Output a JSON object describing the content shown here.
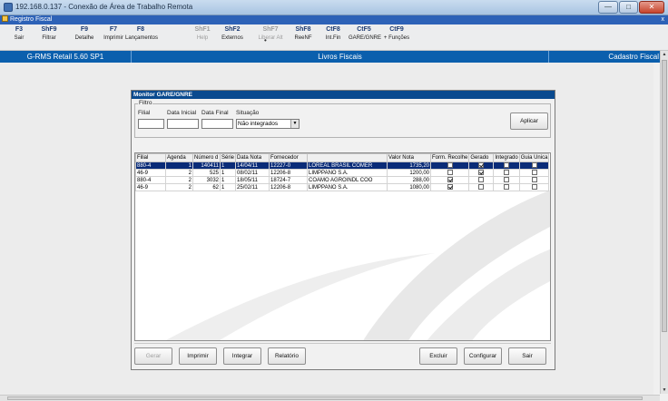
{
  "remote_window": {
    "title": "192.168.0.137 - Conexão de Área de Trabalho Remota",
    "min_label": "—",
    "max_label": "□",
    "close_label": "✕"
  },
  "app": {
    "title": "Registro Fiscal",
    "close_label": "x"
  },
  "toolbar": [
    {
      "key": "F3",
      "label": "Sair",
      "enabled": true
    },
    {
      "key": "ShF9",
      "label": "Filtrar",
      "enabled": true
    },
    {
      "key": "F9",
      "label": "Detalhe",
      "enabled": true
    },
    {
      "key": "F7",
      "label": "Imprimir",
      "enabled": true
    },
    {
      "key": "F8",
      "label": "Lançamentos",
      "enabled": true
    },
    {
      "key": "ShF1",
      "label": "Help",
      "enabled": false
    },
    {
      "key": "ShF2",
      "label": "Externos",
      "enabled": true
    },
    {
      "key": "ShF7",
      "label": "Liberar Alt",
      "enabled": false
    },
    {
      "key": "ShF8",
      "label": "ReeNF",
      "enabled": true
    },
    {
      "key": "CtF8",
      "label": "Int.Fin",
      "enabled": true
    },
    {
      "key": "CtF5",
      "label": "GARE/GNRE",
      "enabled": true
    },
    {
      "key": "CtF9",
      "label": "+ Funções",
      "enabled": true
    }
  ],
  "status_bar": {
    "product": "G-RMS Retail 5.60 SP1",
    "module": "Livros Fiscais",
    "section": "Cadastro Fiscal"
  },
  "dialog": {
    "title": "Monitor GARE/GNRE",
    "filter": {
      "legend": "Filtro",
      "filial_label": "Filial",
      "filial_value": "",
      "data_inicial_label": "Data Inicial",
      "data_inicial_value": "",
      "data_final_label": "Data Final",
      "data_final_value": "",
      "situacao_label": "Situação",
      "situacao_value": "Não integrados",
      "apply_label": "Aplicar"
    },
    "table": {
      "columns": [
        "Filial",
        "Agenda",
        "Número d",
        "Série",
        "Data Nota",
        "Fornecedor",
        "",
        "Valor Nota",
        "Form. Recolhe",
        "Gerado",
        "Integrado",
        "Guia Única"
      ],
      "rows": [
        {
          "filial": "880-4",
          "agenda": "1",
          "numero": "140411",
          "serie": "1",
          "data": "14/04/11",
          "forn_code": "12227-0",
          "forn_name": "LOREAL BRASIL COMER",
          "valor": "1735,20",
          "form": false,
          "gerado": true,
          "integrado": false,
          "guia": false,
          "selected": true
        },
        {
          "filial": "46-9",
          "agenda": "2",
          "numero": "525",
          "serie": "1",
          "data": "08/02/11",
          "forn_code": "12206-8",
          "forn_name": "LIMPPANO S.A.",
          "valor": "1200,00",
          "form": false,
          "gerado": true,
          "integrado": false,
          "guia": false,
          "selected": false
        },
        {
          "filial": "880-4",
          "agenda": "2",
          "numero": "3032",
          "serie": "1",
          "data": "18/05/11",
          "forn_code": "18724-7",
          "forn_name": "COAMO AGROINDL COO",
          "valor": "288,00",
          "form": true,
          "gerado": false,
          "integrado": false,
          "guia": false,
          "selected": false
        },
        {
          "filial": "46-9",
          "agenda": "2",
          "numero": "62",
          "serie": "1",
          "data": "25/02/11",
          "forn_code": "12206-8",
          "forn_name": "LIMPPANO S.A.",
          "valor": "1080,00",
          "form": true,
          "gerado": false,
          "integrado": false,
          "guia": false,
          "selected": false
        }
      ]
    },
    "buttons": {
      "gerar": "Gerar",
      "imprimir": "Imprimir",
      "integrar": "Integrar",
      "relatorio": "Relatório",
      "excluir": "Excluir",
      "configurar": "Configurar",
      "sair": "Sair"
    }
  }
}
